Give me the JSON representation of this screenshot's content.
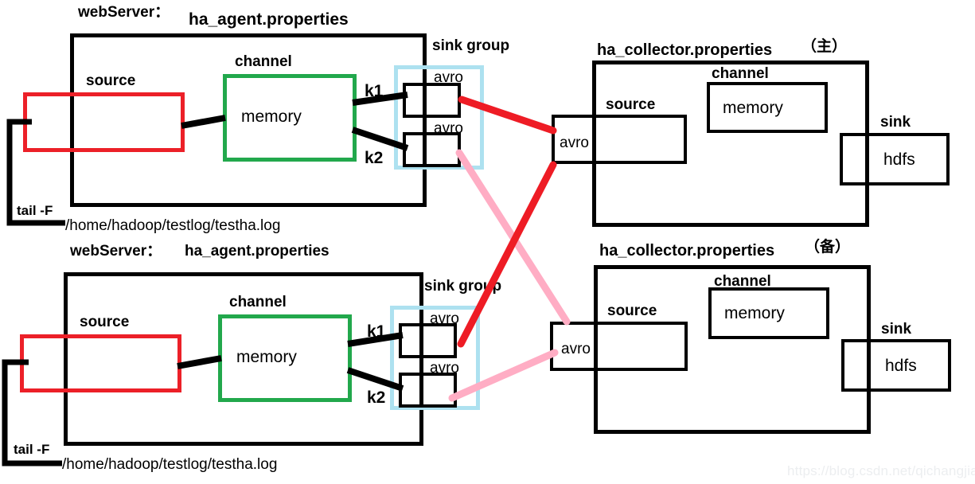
{
  "watermark": "https://blog.csdn.net/qichangjian",
  "colors": {
    "source_border": "#ec2028",
    "channel_border": "#22a84c",
    "sink_group_border": "#ade1f0",
    "box_border": "#000000",
    "primary_link": "#ee1c25",
    "backup_link": "#ffadc4",
    "watermark": "#eceef0"
  },
  "agents": [
    {
      "id": "agent-top",
      "host_label": "webServer：",
      "config_file": "ha_agent.properties",
      "source_label": "source",
      "channel_label": "channel",
      "channel_type": "memory",
      "sink_group_label": "sink  group",
      "sinks": [
        {
          "key": "k1",
          "type": "avro"
        },
        {
          "key": "k2",
          "type": "avro"
        }
      ],
      "tail_command": "tail -F",
      "log_path": "/home/hadoop/testlog/testha.log"
    },
    {
      "id": "agent-bottom",
      "host_label": "webServer：",
      "config_file": "ha_agent.properties",
      "source_label": "source",
      "channel_label": "channel",
      "channel_type": "memory",
      "sink_group_label": "sink  group",
      "sinks": [
        {
          "key": "k1",
          "type": "avro"
        },
        {
          "key": "k2",
          "type": "avro"
        }
      ],
      "tail_command": "tail -F",
      "log_path": "/home/hadoop/testlog/testha.log"
    }
  ],
  "collectors": [
    {
      "id": "collector-primary",
      "config_file": "ha_collector.properties",
      "role": "（主）",
      "source_label": "source",
      "source_type": "avro",
      "channel_label": "channel",
      "channel_type": "memory",
      "sink_label": "sink",
      "sink_type": "hdfs"
    },
    {
      "id": "collector-backup",
      "config_file": "ha_collector.properties",
      "role": "（备）",
      "source_label": "source",
      "source_type": "avro",
      "channel_label": "channel",
      "channel_type": "memory",
      "sink_label": "sink",
      "sink_type": "hdfs"
    }
  ]
}
